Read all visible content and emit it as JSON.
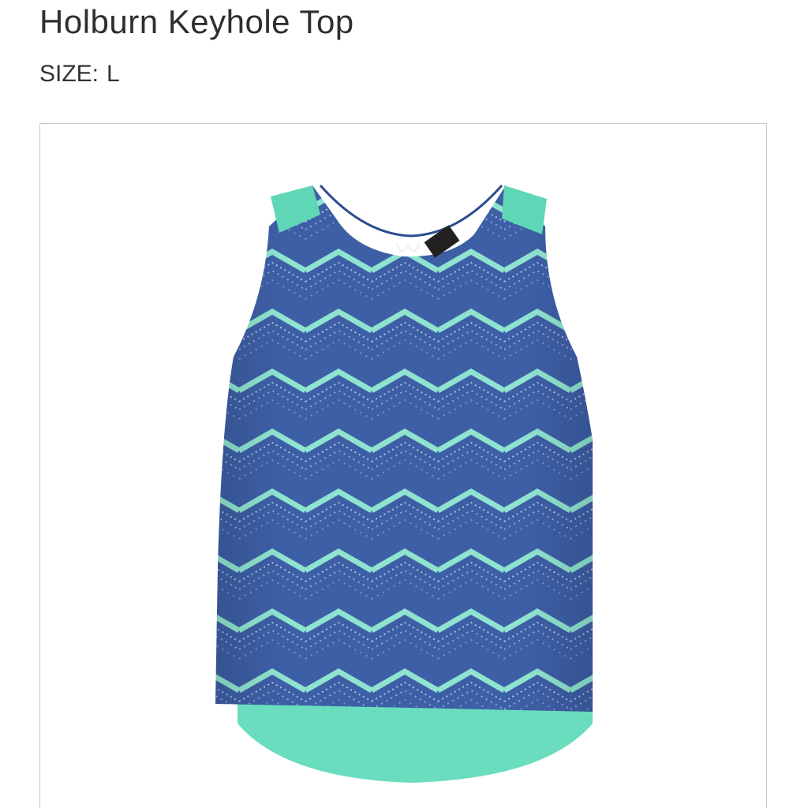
{
  "product": {
    "name": "Holburn Keyhole Top",
    "size_label": "SIZE:",
    "size_value": "L"
  },
  "image": {
    "description_icon": "product-photo-sleeveless-top",
    "colors": {
      "body_blue": "#3d5fa6",
      "zigzag_mint": "#8fe3cf",
      "shoulder_mint": "#5fd6b5",
      "hem_mint": "#69ddbd",
      "frame_border": "#c8c8c8"
    }
  }
}
